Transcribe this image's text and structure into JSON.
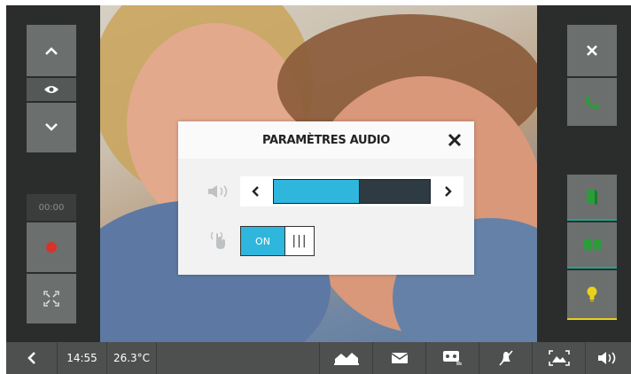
{
  "left_panel": {
    "timer": "00:00"
  },
  "bottom_bar": {
    "time": "14:55",
    "temperature": "26.3°C"
  },
  "dialog": {
    "title": "PARAMÈTRES AUDIO",
    "volume_level": 0.55,
    "toggle_on_label": "ON",
    "toggle_off_label": "|||"
  },
  "colors": {
    "accent": "#2fb6dc",
    "panel_button": "#6b6f6d",
    "call_green": "#2a9d3a",
    "record_red": "#d6342b",
    "light_yellow": "#e8d21e",
    "teal_separator": "#1fa68f"
  }
}
